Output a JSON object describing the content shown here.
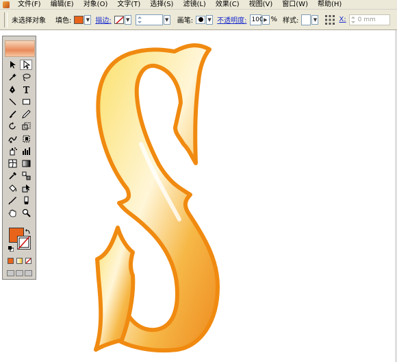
{
  "menubar": {
    "items": [
      "文件(F)",
      "编辑(E)",
      "对象(O)",
      "文字(T)",
      "选择(S)",
      "滤镜(L)",
      "效果(C)",
      "视图(V)",
      "窗口(W)",
      "帮助(H)"
    ]
  },
  "control": {
    "selection_status": "未选择对象",
    "fill_label": "填色:",
    "stroke_label": "描边:",
    "brush_label": "画笔:",
    "opacity_label": "不透明度:",
    "opacity_value": "100",
    "opacity_unit": "%",
    "style_label": "样式:",
    "x_label": "X:",
    "x_value": "0 mm"
  },
  "colors": {
    "fill": "#e8641a",
    "stroke": "#ffffff",
    "accent_link": "#1a2ccc"
  },
  "toolbox": {
    "tools": [
      "selection-arrow",
      "direct-selection-arrow",
      "magic-wand",
      "lasso",
      "pen",
      "type",
      "line-segment",
      "rectangle",
      "paintbrush",
      "pencil",
      "rotate",
      "scale",
      "warp",
      "free-transform",
      "symbol-sprayer",
      "column-graph",
      "mesh",
      "gradient",
      "eyedropper",
      "blend",
      "live-paint-bucket",
      "live-paint-selection",
      "slice",
      "eraser",
      "hand",
      "zoom"
    ]
  }
}
